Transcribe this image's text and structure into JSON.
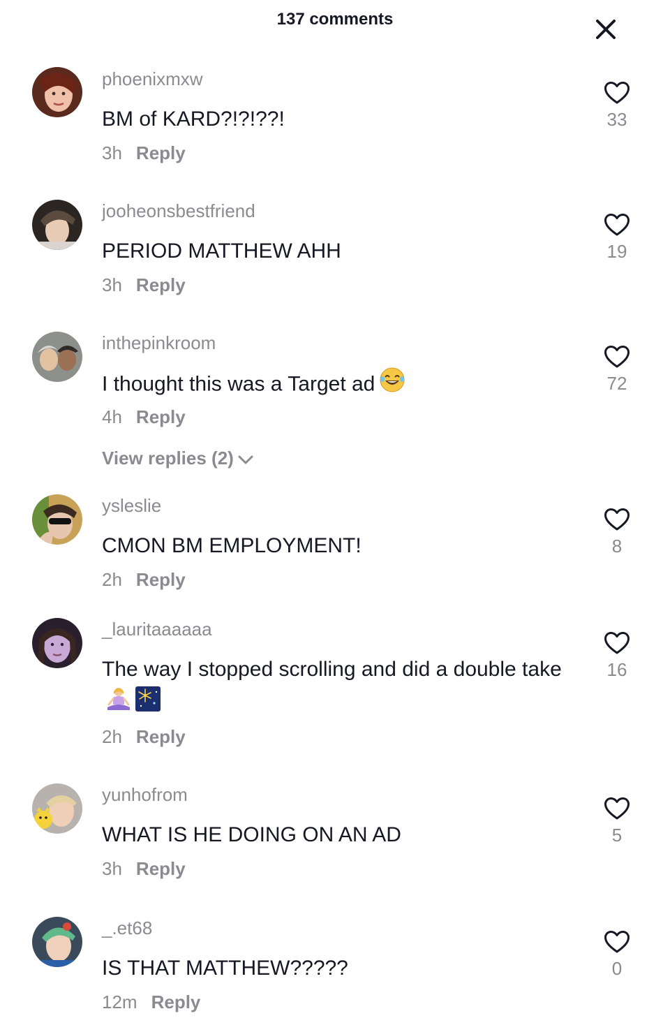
{
  "header": {
    "title": "137 comments",
    "close_icon": "close-icon"
  },
  "comments": [
    {
      "username": "phoenixmxw",
      "text": "BM of KARD?!?!??!",
      "time": "3h",
      "reply_label": "Reply",
      "likes": "33"
    },
    {
      "username": "jooheonsbestfriend",
      "text": "PERIOD MATTHEW AHH",
      "time": "3h",
      "reply_label": "Reply",
      "likes": "19"
    },
    {
      "username": "inthepinkroom",
      "text": "I thought this was a Target ad",
      "emoji": "laughing-emoji",
      "time": "4h",
      "reply_label": "Reply",
      "view_replies": "View replies (2)",
      "likes": "72"
    },
    {
      "username": "ysleslie",
      "text": "CMON BM EMPLOYMENT!",
      "time": "2h",
      "reply_label": "Reply",
      "likes": "8"
    },
    {
      "username": "_lauritaaaaaa",
      "text": "The way I stopped scrolling and did a double take",
      "emojis": [
        "meditating-woman-emoji",
        "fireworks-emoji"
      ],
      "time": "2h",
      "reply_label": "Reply",
      "likes": "16"
    },
    {
      "username": "yunhofrom",
      "text": "WHAT IS HE DOING ON AN AD",
      "time": "3h",
      "reply_label": "Reply",
      "likes": "5"
    },
    {
      "username": "_.et68",
      "text": "IS THAT MATTHEW?????",
      "time": "12m",
      "reply_label": "Reply",
      "likes": "0"
    }
  ],
  "colors": {
    "primary_text": "#161823",
    "secondary_text": "#8a8b91",
    "background": "#ffffff"
  }
}
